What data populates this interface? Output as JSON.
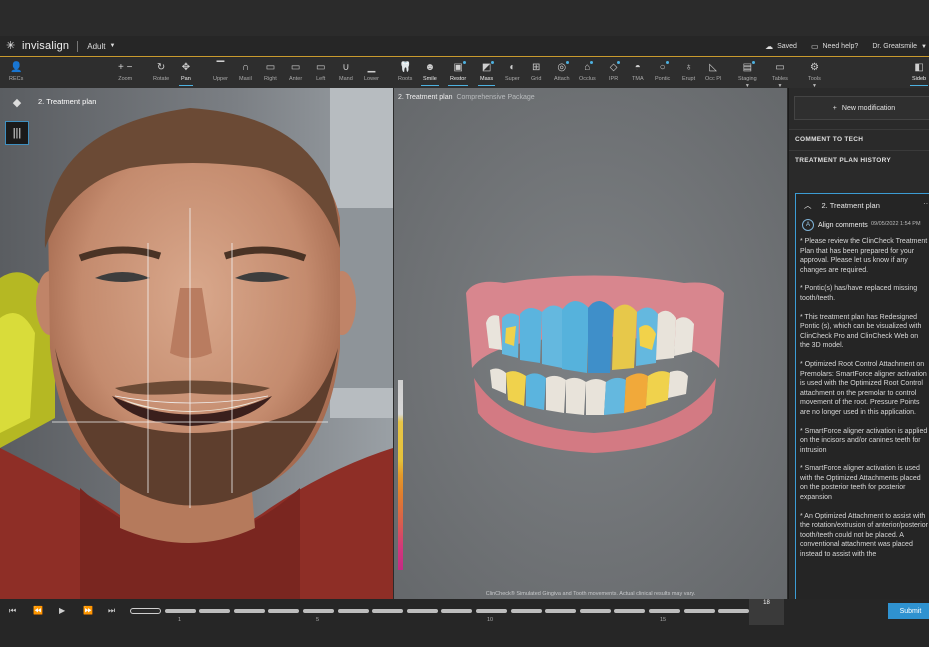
{
  "header": {
    "brand": "invisalign",
    "patient_type": "Adult",
    "saved": "Saved",
    "help": "Need help?",
    "user": "Dr. Greatsmile"
  },
  "toolbar": {
    "recs": "RECs",
    "zoom": "Zoom",
    "rotate": "Rotate",
    "pan": "Pan",
    "upper": "Upper",
    "maxil": "Maxil",
    "right": "Right",
    "anter": "Anter",
    "left": "Left",
    "mand": "Mand",
    "lower": "Lower",
    "roots": "Roots",
    "smile": "Smile",
    "restor": "Restor",
    "mass": "Mass",
    "super": "Super",
    "grid": "Grid",
    "attach": "Attach",
    "occlus": "Occlus",
    "ipr": "IPR",
    "tma": "TMA",
    "pontic": "Pontic",
    "erupt": "Erupt",
    "occpl": "Occ Pl",
    "staging": "Staging",
    "tables": "Tables",
    "tools": "Tools",
    "sidebar": "Sideb"
  },
  "photo": {
    "title": "2. Treatment plan"
  },
  "viewer": {
    "title": "2. Treatment plan",
    "subtitle": "Comprehensive Package",
    "disclaimer": "ClinCheck® Simulated Gingiva and Tooth movements. Actual clinical results may vary."
  },
  "sidebar": {
    "new_modification": "New modification",
    "comment_to_tech": "COMMENT TO TECH",
    "treatment_plan_history": "TREATMENT PLAN HISTORY",
    "card_title": "2. Treatment plan",
    "author": "Align comments",
    "date": "09/05/2022 1:54 PM",
    "comments": [
      "* Please review the ClinCheck Treatment Plan that has been prepared for your approval. Please let us know if any changes are required.",
      "* Pontic(s) has/have replaced missing tooth/teeth.",
      "* This treatment plan has Redesigned Pontic (s), which can be visualized with ClinCheck Pro and ClinCheck Web on the 3D model.",
      "* Optimized Root Control Attachment on Premolars: SmartForce aligner activation is used with the Optimized Root Control attachment on the premolar to control movement of the root. Pressure Points are no longer used in this application.",
      "* SmartForce aligner activation is applied on the incisors and/or canines teeth for intrusion",
      "* SmartForce aligner activation is used with the Optimized Attachments placed on the posterior teeth for posterior expansion",
      "* An Optimized Attachment to assist with the rotation/extrusion of anterior/posterior tooth/teeth could not be placed. A conventional attachment was placed instead to assist with the"
    ]
  },
  "timeline": {
    "ticks": [
      "1",
      "5",
      "10",
      "15"
    ],
    "current_stage": "18",
    "submit": "Submit"
  },
  "colors": {
    "accent": "#2f92d0",
    "header_line": "#c99a2e"
  }
}
